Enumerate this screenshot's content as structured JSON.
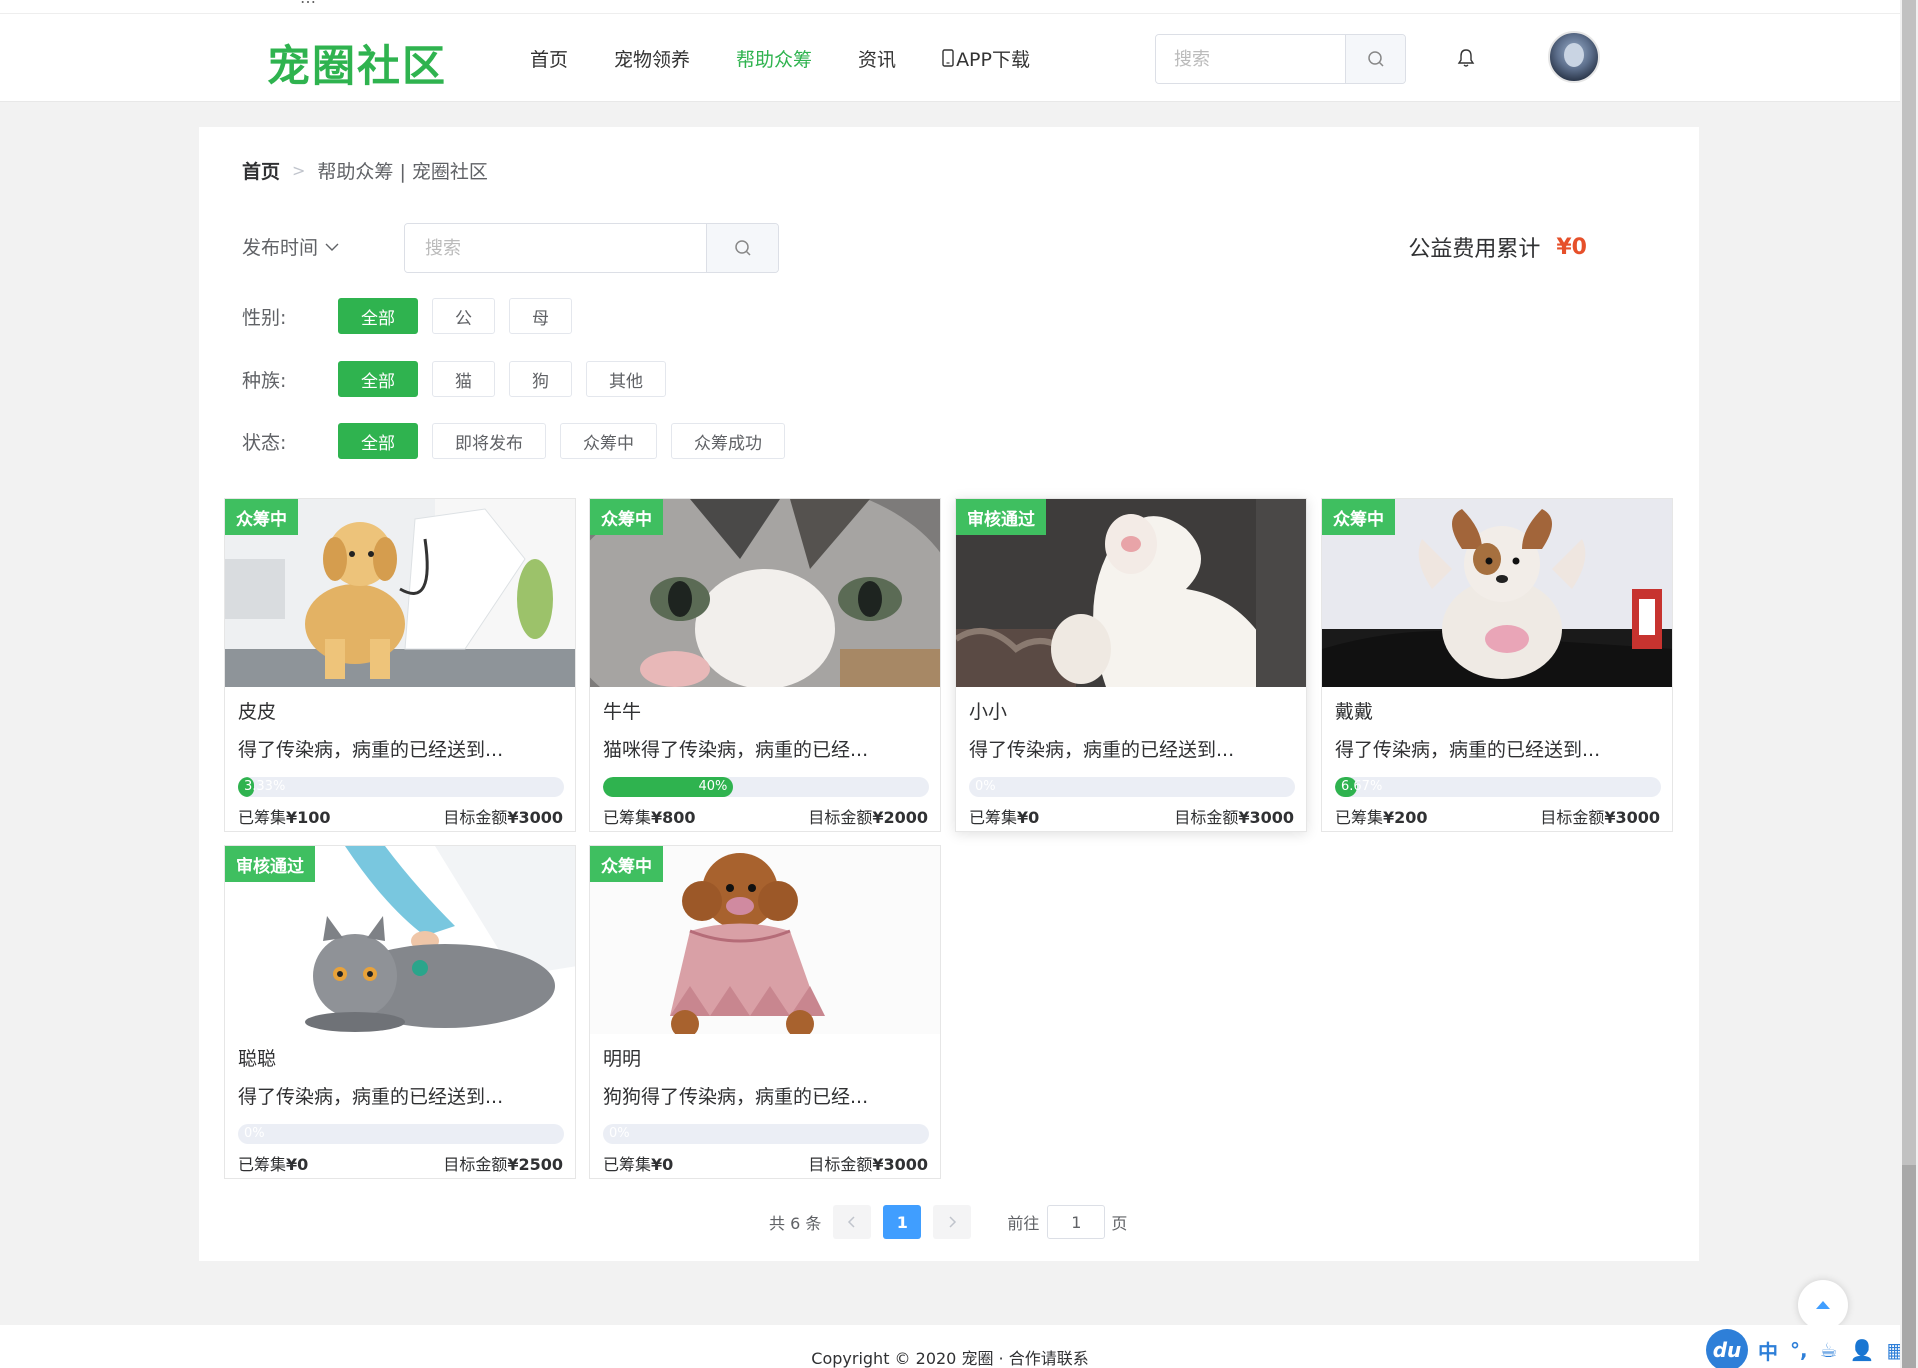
{
  "top_strip": {
    "text": "…"
  },
  "header": {
    "logo": "宠圈社区",
    "nav": [
      "首页",
      "宠物领养",
      "帮助众筹",
      "资讯",
      "APP下载"
    ],
    "active_nav": "帮助众筹",
    "search_placeholder": "搜索"
  },
  "breadcrumb": {
    "home": "首页",
    "current": "帮助众筹 | 宠圈社区"
  },
  "toolbar": {
    "sort_label": "发布时间",
    "search_placeholder": "搜索",
    "total_label": "公益费用累计",
    "total_amount": "¥0"
  },
  "filters": {
    "gender": {
      "label": "性别:",
      "options": [
        "全部",
        "公",
        "母"
      ],
      "selected": "全部"
    },
    "species": {
      "label": "种族:",
      "options": [
        "全部",
        "猫",
        "狗",
        "其他"
      ],
      "selected": "全部"
    },
    "status": {
      "label": "状态:",
      "options": [
        "全部",
        "即将发布",
        "众筹中",
        "众筹成功"
      ],
      "selected": "全部"
    }
  },
  "cards": [
    {
      "tag": "众筹中",
      "name": "皮皮",
      "desc": "得了传染病，病重的已经送到...",
      "progress": 3.33,
      "pct_label": "3.33%",
      "raised_label": "已筹集",
      "raised": "¥100",
      "target_label": "目标金额",
      "target": "¥3000",
      "image": "golden-puppy-at-vet"
    },
    {
      "tag": "众筹中",
      "name": "牛牛",
      "desc": "猫咪得了传染病，病重的已经...",
      "progress": 40,
      "pct_label": "40%",
      "raised_label": "已筹集",
      "raised": "¥800",
      "target_label": "目标金额",
      "target": "¥2000",
      "image": "tabby-kitten-closeup"
    },
    {
      "tag": "审核通过",
      "name": "小小",
      "desc": "得了传染病，病重的已经送到...",
      "progress": 0,
      "pct_label": "0%",
      "raised_label": "已筹集",
      "raised": "¥0",
      "target_label": "目标金额",
      "target": "¥3000",
      "image": "white-fluffy-pet"
    },
    {
      "tag": "众筹中",
      "name": "戴戴",
      "desc": "得了传染病，病重的已经送到...",
      "progress": 6.67,
      "pct_label": "6.67%",
      "raised_label": "已筹集",
      "raised": "¥200",
      "target_label": "目标金额",
      "target": "¥3000",
      "image": "corgi-puppy"
    },
    {
      "tag": "审核通过",
      "name": "聪聪",
      "desc": "得了传染病，病重的已经送到...",
      "progress": 0,
      "pct_label": "0%",
      "raised_label": "已筹集",
      "raised": "¥0",
      "target_label": "目标金额",
      "target": "¥2500",
      "image": "grey-cat-stethoscope"
    },
    {
      "tag": "众筹中",
      "name": "明明",
      "desc": "狗狗得了传染病，病重的已经...",
      "progress": 0,
      "pct_label": "0%",
      "raised_label": "已筹集",
      "raised": "¥0",
      "target_label": "目标金额",
      "target": "¥3000",
      "image": "poodle-in-dress"
    }
  ],
  "pagination": {
    "total": "共 6 条",
    "current": "1",
    "goto_label": "前往",
    "goto_value": "1",
    "page_suffix": "页"
  },
  "footer": {
    "text": "Copyright © 2020 宠圈 · 合作请联系"
  },
  "ime": {
    "logo": "du",
    "items": [
      "中",
      "°,",
      "☕",
      "👤",
      "▦"
    ]
  },
  "colors": {
    "brand": "#2fb34f",
    "accent_red": "#e6502a",
    "page_blue": "#409eff"
  }
}
